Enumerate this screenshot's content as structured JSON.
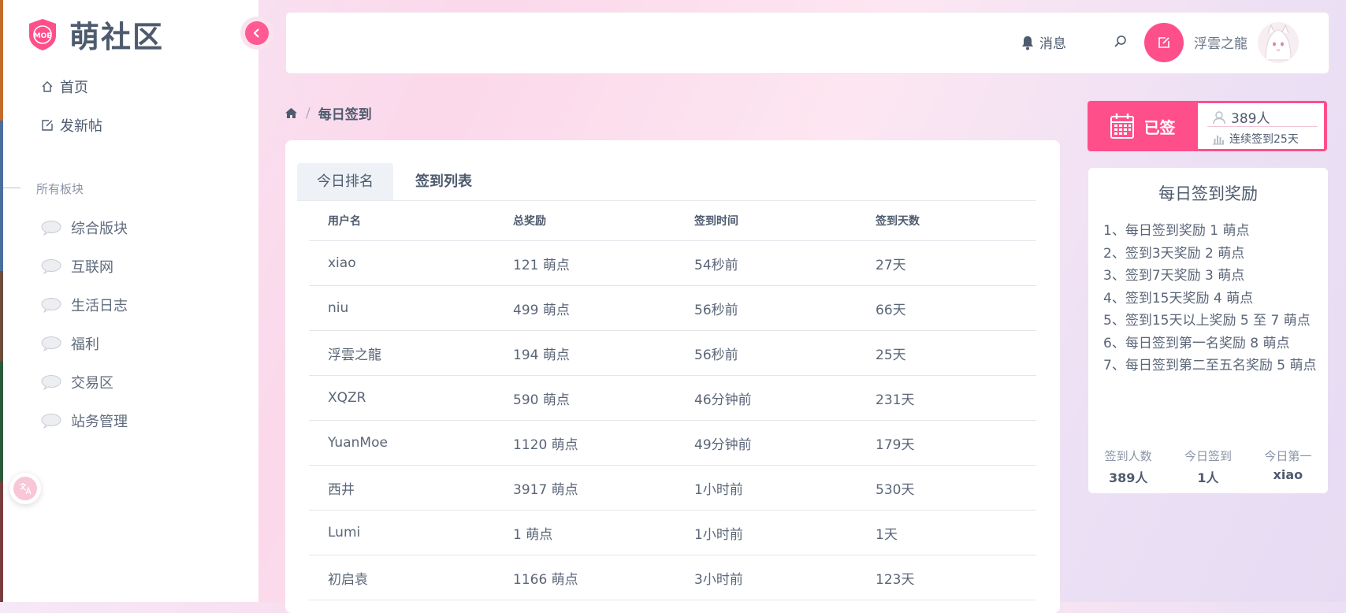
{
  "sidebar": {
    "logo_badge": "MOE",
    "logo_title": "萌社区",
    "nav": [
      {
        "label": "首页",
        "icon": "home-icon"
      },
      {
        "label": "发新帖",
        "icon": "edit-icon"
      }
    ],
    "section_label": "所有板块",
    "boards": [
      "综合版块",
      "互联网",
      "生活日志",
      "福利",
      "交易区",
      "站务管理"
    ]
  },
  "header": {
    "notice_label": "消息",
    "username": "浮雲之龍"
  },
  "breadcrumb": {
    "separator": "/",
    "current": "每日签到"
  },
  "tabs": [
    "今日排名",
    "签到列表"
  ],
  "table": {
    "columns": [
      "用户名",
      "总奖励",
      "签到时间",
      "签到天数"
    ],
    "rows": [
      [
        "xiao",
        "121 萌点",
        "54秒前",
        "27天"
      ],
      [
        "niu",
        "499 萌点",
        "56秒前",
        "66天"
      ],
      [
        "浮雲之龍",
        "194 萌点",
        "56秒前",
        "25天"
      ],
      [
        "XQZR",
        "590 萌点",
        "46分钟前",
        "231天"
      ],
      [
        "YuanMoe",
        "1120 萌点",
        "49分钟前",
        "179天"
      ],
      [
        "西井",
        "3917 萌点",
        "1小时前",
        "530天"
      ],
      [
        "Lumi",
        "1 萌点",
        "1小时前",
        "1天"
      ],
      [
        "初启袁",
        "1166 萌点",
        "3小时前",
        "123天"
      ]
    ]
  },
  "checkin": {
    "status": "已签",
    "count": "389人",
    "streak": "连续签到25天"
  },
  "reward": {
    "title": "每日签到奖励",
    "rules": [
      "1、每日签到奖励 1 萌点",
      "2、签到3天奖励 2 萌点",
      "3、签到7天奖励 3 萌点",
      "4、签到15天奖励 4 萌点",
      "5、签到15天以上奖励 5 至 7 萌点",
      "6、每日签到第一名奖励 8 萌点",
      "7、每日签到第二至五名奖励 5 萌点"
    ],
    "stats": [
      {
        "label": "签到人数",
        "value": "389人"
      },
      {
        "label": "今日签到",
        "value": "1人"
      },
      {
        "label": "今日第一",
        "value": "xiao"
      }
    ]
  },
  "colors": {
    "accent": "#ff4f8b",
    "text": "#4e5b6e"
  }
}
